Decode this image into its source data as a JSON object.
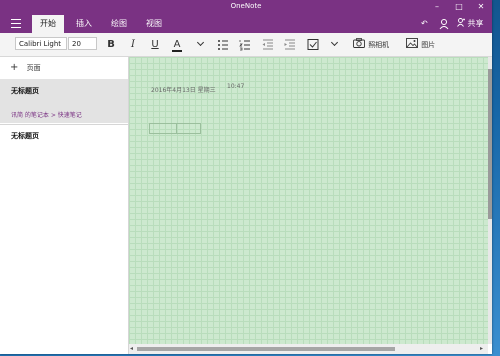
{
  "app": {
    "title": "OneNote"
  },
  "window_controls": {
    "minimize": "–",
    "maximize": "□",
    "close": "✕"
  },
  "tabs": [
    {
      "label": "开始"
    },
    {
      "label": "插入"
    },
    {
      "label": "绘图"
    },
    {
      "label": "视图"
    }
  ],
  "tab_actions": {
    "share_label": "共享",
    "undo_icon": "↶",
    "person_icon": "user"
  },
  "toolbar": {
    "font_name": "Calibri Light",
    "font_size": "20",
    "bold": "B",
    "italic": "I",
    "underline": "U",
    "font_color": "A",
    "camera_label": "照相机",
    "picture_label": "图片",
    "accent_color": "#7a3283",
    "font_color_value": "#222222"
  },
  "sidebar": {
    "add_page": "页面",
    "pages": [
      {
        "title": "无标题页",
        "path": "讯简 的笔记本 > 快速笔记",
        "selected": true
      },
      {
        "title": "无标题页",
        "selected": false
      }
    ]
  },
  "canvas": {
    "date": "2016年4月13日 星期三",
    "time": "10:47",
    "background_color": "#cde9cf"
  }
}
